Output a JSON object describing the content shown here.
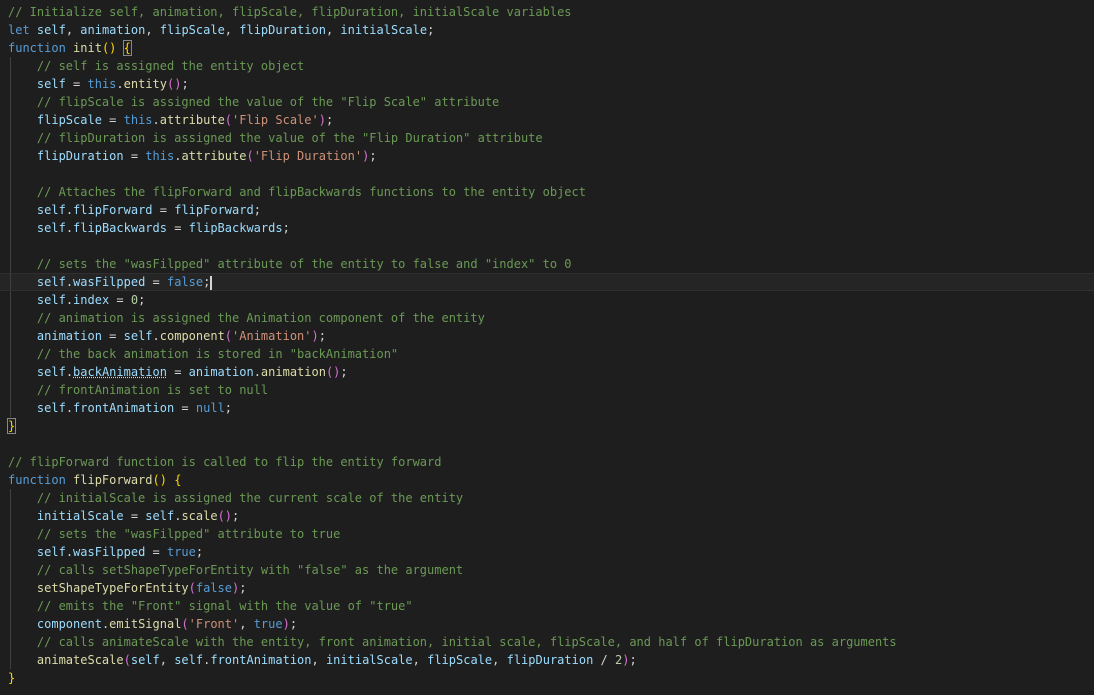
{
  "editor": {
    "lines": [
      {
        "indent": 0,
        "tokens": [
          {
            "t": "// Initialize self, animation, flipScale, flipDuration, initialScale variables",
            "c": "comment"
          }
        ]
      },
      {
        "indent": 0,
        "tokens": [
          {
            "t": "let",
            "c": "keyword"
          },
          {
            "t": " ",
            "c": "plain"
          },
          {
            "t": "self",
            "c": "var"
          },
          {
            "t": ", ",
            "c": "punct"
          },
          {
            "t": "animation",
            "c": "var"
          },
          {
            "t": ", ",
            "c": "punct"
          },
          {
            "t": "flipScale",
            "c": "var"
          },
          {
            "t": ", ",
            "c": "punct"
          },
          {
            "t": "flipDuration",
            "c": "var"
          },
          {
            "t": ", ",
            "c": "punct"
          },
          {
            "t": "initialScale",
            "c": "var"
          },
          {
            "t": ";",
            "c": "punct"
          }
        ]
      },
      {
        "indent": 0,
        "tokens": [
          {
            "t": "function",
            "c": "keyword"
          },
          {
            "t": " ",
            "c": "plain"
          },
          {
            "t": "init",
            "c": "func"
          },
          {
            "t": "()",
            "c": "bracket"
          },
          {
            "t": " ",
            "c": "plain"
          },
          {
            "t": "{",
            "c": "bracket",
            "match": true
          }
        ]
      },
      {
        "indent": 1,
        "tokens": [
          {
            "t": "// self is assigned the entity object",
            "c": "comment"
          }
        ]
      },
      {
        "indent": 1,
        "tokens": [
          {
            "t": "self",
            "c": "var"
          },
          {
            "t": " = ",
            "c": "punct"
          },
          {
            "t": "this",
            "c": "keyword"
          },
          {
            "t": ".",
            "c": "punct"
          },
          {
            "t": "entity",
            "c": "func"
          },
          {
            "t": "()",
            "c": "bracket2"
          },
          {
            "t": ";",
            "c": "punct"
          }
        ]
      },
      {
        "indent": 1,
        "tokens": [
          {
            "t": "// flipScale is assigned the value of the \"Flip Scale\" attribute",
            "c": "comment"
          }
        ]
      },
      {
        "indent": 1,
        "tokens": [
          {
            "t": "flipScale",
            "c": "var"
          },
          {
            "t": " = ",
            "c": "punct"
          },
          {
            "t": "this",
            "c": "keyword"
          },
          {
            "t": ".",
            "c": "punct"
          },
          {
            "t": "attribute",
            "c": "func"
          },
          {
            "t": "(",
            "c": "bracket2"
          },
          {
            "t": "'Flip Scale'",
            "c": "string"
          },
          {
            "t": ")",
            "c": "bracket2"
          },
          {
            "t": ";",
            "c": "punct"
          }
        ]
      },
      {
        "indent": 1,
        "tokens": [
          {
            "t": "// flipDuration is assigned the value of the \"Flip Duration\" attribute",
            "c": "comment"
          }
        ]
      },
      {
        "indent": 1,
        "tokens": [
          {
            "t": "flipDuration",
            "c": "var"
          },
          {
            "t": " = ",
            "c": "punct"
          },
          {
            "t": "this",
            "c": "keyword"
          },
          {
            "t": ".",
            "c": "punct"
          },
          {
            "t": "attribute",
            "c": "func"
          },
          {
            "t": "(",
            "c": "bracket2"
          },
          {
            "t": "'Flip Duration'",
            "c": "string"
          },
          {
            "t": ")",
            "c": "bracket2"
          },
          {
            "t": ";",
            "c": "punct"
          }
        ]
      },
      {
        "indent": 1,
        "tokens": []
      },
      {
        "indent": 1,
        "tokens": [
          {
            "t": "// Attaches the flipForward and flipBackwards functions to the entity object",
            "c": "comment"
          }
        ]
      },
      {
        "indent": 1,
        "tokens": [
          {
            "t": "self",
            "c": "var"
          },
          {
            "t": ".",
            "c": "punct"
          },
          {
            "t": "flipForward",
            "c": "var"
          },
          {
            "t": " = ",
            "c": "punct"
          },
          {
            "t": "flipForward",
            "c": "var"
          },
          {
            "t": ";",
            "c": "punct"
          }
        ]
      },
      {
        "indent": 1,
        "tokens": [
          {
            "t": "self",
            "c": "var"
          },
          {
            "t": ".",
            "c": "punct"
          },
          {
            "t": "flipBackwards",
            "c": "var"
          },
          {
            "t": " = ",
            "c": "punct"
          },
          {
            "t": "flipBackwards",
            "c": "var"
          },
          {
            "t": ";",
            "c": "punct"
          }
        ]
      },
      {
        "indent": 1,
        "tokens": []
      },
      {
        "indent": 1,
        "tokens": [
          {
            "t": "// sets the \"wasFilpped\" attribute of the entity to false and \"index\" to 0",
            "c": "comment"
          }
        ]
      },
      {
        "indent": 1,
        "current": true,
        "cursor": true,
        "tokens": [
          {
            "t": "self",
            "c": "var"
          },
          {
            "t": ".",
            "c": "punct"
          },
          {
            "t": "wasFilpped",
            "c": "var"
          },
          {
            "t": " = ",
            "c": "punct"
          },
          {
            "t": "false",
            "c": "keyword"
          },
          {
            "t": ";",
            "c": "punct"
          }
        ]
      },
      {
        "indent": 1,
        "tokens": [
          {
            "t": "self",
            "c": "var"
          },
          {
            "t": ".",
            "c": "punct"
          },
          {
            "t": "index",
            "c": "var"
          },
          {
            "t": " = ",
            "c": "punct"
          },
          {
            "t": "0",
            "c": "num"
          },
          {
            "t": ";",
            "c": "punct"
          }
        ]
      },
      {
        "indent": 1,
        "tokens": [
          {
            "t": "// animation is assigned the Animation component of the entity",
            "c": "comment"
          }
        ]
      },
      {
        "indent": 1,
        "tokens": [
          {
            "t": "animation",
            "c": "var"
          },
          {
            "t": " = ",
            "c": "punct"
          },
          {
            "t": "self",
            "c": "var"
          },
          {
            "t": ".",
            "c": "punct"
          },
          {
            "t": "component",
            "c": "func"
          },
          {
            "t": "(",
            "c": "bracket2"
          },
          {
            "t": "'Animation'",
            "c": "string"
          },
          {
            "t": ")",
            "c": "bracket2"
          },
          {
            "t": ";",
            "c": "punct"
          }
        ]
      },
      {
        "indent": 1,
        "tokens": [
          {
            "t": "// the back animation is stored in \"backAnimation\"",
            "c": "comment"
          }
        ]
      },
      {
        "indent": 1,
        "tokens": [
          {
            "t": "self",
            "c": "var"
          },
          {
            "t": ".",
            "c": "punct"
          },
          {
            "t": "backAnimation",
            "c": "var",
            "squiggle": true
          },
          {
            "t": " = ",
            "c": "punct"
          },
          {
            "t": "animation",
            "c": "var"
          },
          {
            "t": ".",
            "c": "punct"
          },
          {
            "t": "animation",
            "c": "func"
          },
          {
            "t": "()",
            "c": "bracket2"
          },
          {
            "t": ";",
            "c": "punct"
          }
        ]
      },
      {
        "indent": 1,
        "tokens": [
          {
            "t": "// frontAnimation is set to null",
            "c": "comment"
          }
        ]
      },
      {
        "indent": 1,
        "tokens": [
          {
            "t": "self",
            "c": "var"
          },
          {
            "t": ".",
            "c": "punct"
          },
          {
            "t": "frontAnimation",
            "c": "var"
          },
          {
            "t": " = ",
            "c": "punct"
          },
          {
            "t": "null",
            "c": "keyword"
          },
          {
            "t": ";",
            "c": "punct"
          }
        ]
      },
      {
        "indent": 0,
        "tokens": [
          {
            "t": "}",
            "c": "bracket",
            "match": true
          }
        ]
      },
      {
        "indent": 0,
        "tokens": []
      },
      {
        "indent": 0,
        "tokens": [
          {
            "t": "// flipForward function is called to flip the entity forward",
            "c": "comment"
          }
        ]
      },
      {
        "indent": 0,
        "tokens": [
          {
            "t": "function",
            "c": "keyword"
          },
          {
            "t": " ",
            "c": "plain"
          },
          {
            "t": "flipForward",
            "c": "func"
          },
          {
            "t": "()",
            "c": "bracket"
          },
          {
            "t": " ",
            "c": "plain"
          },
          {
            "t": "{",
            "c": "bracket"
          }
        ]
      },
      {
        "indent": 1,
        "tokens": [
          {
            "t": "// initialScale is assigned the current scale of the entity",
            "c": "comment"
          }
        ]
      },
      {
        "indent": 1,
        "tokens": [
          {
            "t": "initialScale",
            "c": "var"
          },
          {
            "t": " = ",
            "c": "punct"
          },
          {
            "t": "self",
            "c": "var"
          },
          {
            "t": ".",
            "c": "punct"
          },
          {
            "t": "scale",
            "c": "func"
          },
          {
            "t": "()",
            "c": "bracket2"
          },
          {
            "t": ";",
            "c": "punct"
          }
        ]
      },
      {
        "indent": 1,
        "tokens": [
          {
            "t": "// sets the \"wasFilpped\" attribute to true",
            "c": "comment"
          }
        ]
      },
      {
        "indent": 1,
        "tokens": [
          {
            "t": "self",
            "c": "var"
          },
          {
            "t": ".",
            "c": "punct"
          },
          {
            "t": "wasFilpped",
            "c": "var"
          },
          {
            "t": " = ",
            "c": "punct"
          },
          {
            "t": "true",
            "c": "keyword"
          },
          {
            "t": ";",
            "c": "punct"
          }
        ]
      },
      {
        "indent": 1,
        "tokens": [
          {
            "t": "// calls setShapeTypeForEntity with \"false\" as the argument",
            "c": "comment"
          }
        ]
      },
      {
        "indent": 1,
        "tokens": [
          {
            "t": "setShapeTypeForEntity",
            "c": "func"
          },
          {
            "t": "(",
            "c": "bracket2"
          },
          {
            "t": "false",
            "c": "keyword"
          },
          {
            "t": ")",
            "c": "bracket2"
          },
          {
            "t": ";",
            "c": "punct"
          }
        ]
      },
      {
        "indent": 1,
        "tokens": [
          {
            "t": "// emits the \"Front\" signal with the value of \"true\"",
            "c": "comment"
          }
        ]
      },
      {
        "indent": 1,
        "tokens": [
          {
            "t": "component",
            "c": "var"
          },
          {
            "t": ".",
            "c": "punct"
          },
          {
            "t": "emitSignal",
            "c": "func"
          },
          {
            "t": "(",
            "c": "bracket2"
          },
          {
            "t": "'Front'",
            "c": "string"
          },
          {
            "t": ", ",
            "c": "punct"
          },
          {
            "t": "true",
            "c": "keyword"
          },
          {
            "t": ")",
            "c": "bracket2"
          },
          {
            "t": ";",
            "c": "punct"
          }
        ]
      },
      {
        "indent": 1,
        "tokens": [
          {
            "t": "// calls animateScale with the entity, front animation, initial scale, flipScale, and half of flipDuration as arguments",
            "c": "comment"
          }
        ]
      },
      {
        "indent": 1,
        "tokens": [
          {
            "t": "animateScale",
            "c": "func"
          },
          {
            "t": "(",
            "c": "bracket2"
          },
          {
            "t": "self",
            "c": "var"
          },
          {
            "t": ", ",
            "c": "punct"
          },
          {
            "t": "self",
            "c": "var"
          },
          {
            "t": ".",
            "c": "punct"
          },
          {
            "t": "frontAnimation",
            "c": "var"
          },
          {
            "t": ", ",
            "c": "punct"
          },
          {
            "t": "initialScale",
            "c": "var"
          },
          {
            "t": ", ",
            "c": "punct"
          },
          {
            "t": "flipScale",
            "c": "var"
          },
          {
            "t": ", ",
            "c": "punct"
          },
          {
            "t": "flipDuration",
            "c": "var"
          },
          {
            "t": " / ",
            "c": "punct"
          },
          {
            "t": "2",
            "c": "num"
          },
          {
            "t": ")",
            "c": "bracket2"
          },
          {
            "t": ";",
            "c": "punct"
          }
        ]
      },
      {
        "indent": 0,
        "tokens": [
          {
            "t": "}",
            "c": "bracket"
          }
        ]
      }
    ]
  }
}
